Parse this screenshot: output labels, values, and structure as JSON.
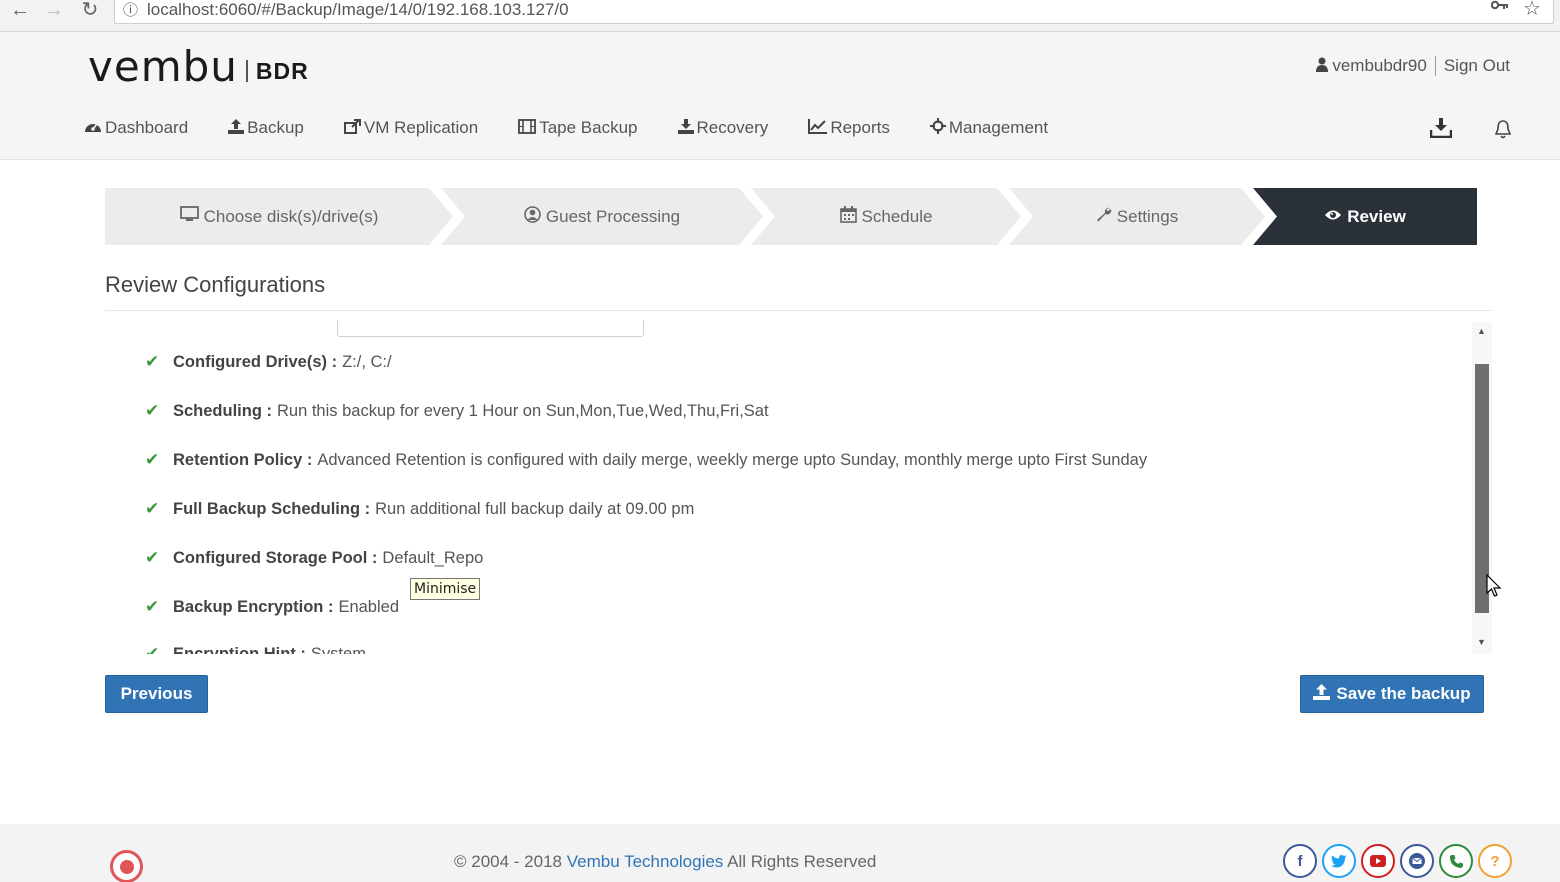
{
  "browser": {
    "back": "←",
    "forward": "→",
    "reload": "↻",
    "info": "ⓘ",
    "url": "localhost:6060/#/Backup/Image/14/0/192.168.103.127/0"
  },
  "header": {
    "logo_main": "vembu",
    "logo_sub": "BDR",
    "username": "vembubdr90",
    "sign_out": "Sign Out"
  },
  "nav": {
    "items": [
      {
        "label": "Dashboard",
        "icon": "dashboard-icon"
      },
      {
        "label": "Backup",
        "icon": "upload-icon"
      },
      {
        "label": "VM Replication",
        "icon": "share-icon"
      },
      {
        "label": "Tape Backup",
        "icon": "film-icon"
      },
      {
        "label": "Recovery",
        "icon": "download-icon"
      },
      {
        "label": "Reports",
        "icon": "line-chart-icon"
      },
      {
        "label": "Management",
        "icon": "crosshairs-icon"
      }
    ]
  },
  "wizard": {
    "steps": [
      {
        "label": "Choose disk(s)/drive(s)",
        "icon": "monitor-icon"
      },
      {
        "label": "Guest Processing",
        "icon": "user-circle-icon"
      },
      {
        "label": "Schedule",
        "icon": "calendar-icon"
      },
      {
        "label": "Settings",
        "icon": "wrench-icon"
      },
      {
        "label": "Review",
        "icon": "eye-icon",
        "active": true
      }
    ]
  },
  "review": {
    "title": "Review Configurations",
    "items": [
      {
        "label": "Configured Drive(s) :",
        "value": "Z:/, C:/"
      },
      {
        "label": "Scheduling :",
        "value": "Run this backup for every 1 Hour on Sun,Mon,Tue,Wed,Thu,Fri,Sat"
      },
      {
        "label": "Retention Policy :",
        "value": "Advanced Retention is configured with daily merge, weekly merge upto Sunday, monthly merge upto First Sunday"
      },
      {
        "label": "Full Backup Scheduling :",
        "value": "Run additional full backup daily at 09.00 pm"
      },
      {
        "label": "Configured Storage Pool :",
        "value": "Default_Repo"
      },
      {
        "label": "Backup Encryption :",
        "value": "Enabled"
      },
      {
        "label": "Encryption Hint :",
        "value": "System"
      }
    ]
  },
  "tooltip": "Minimise",
  "buttons": {
    "previous": "Previous",
    "save": "Save the backup"
  },
  "footer": {
    "copyright_prefix": "© 2004 - 2018",
    "company": "Vembu Technologies",
    "rights": "All Rights Reserved"
  },
  "colors": {
    "primary": "#3174b6",
    "active_step": "#2b3138",
    "check": "#3a9a3a"
  }
}
